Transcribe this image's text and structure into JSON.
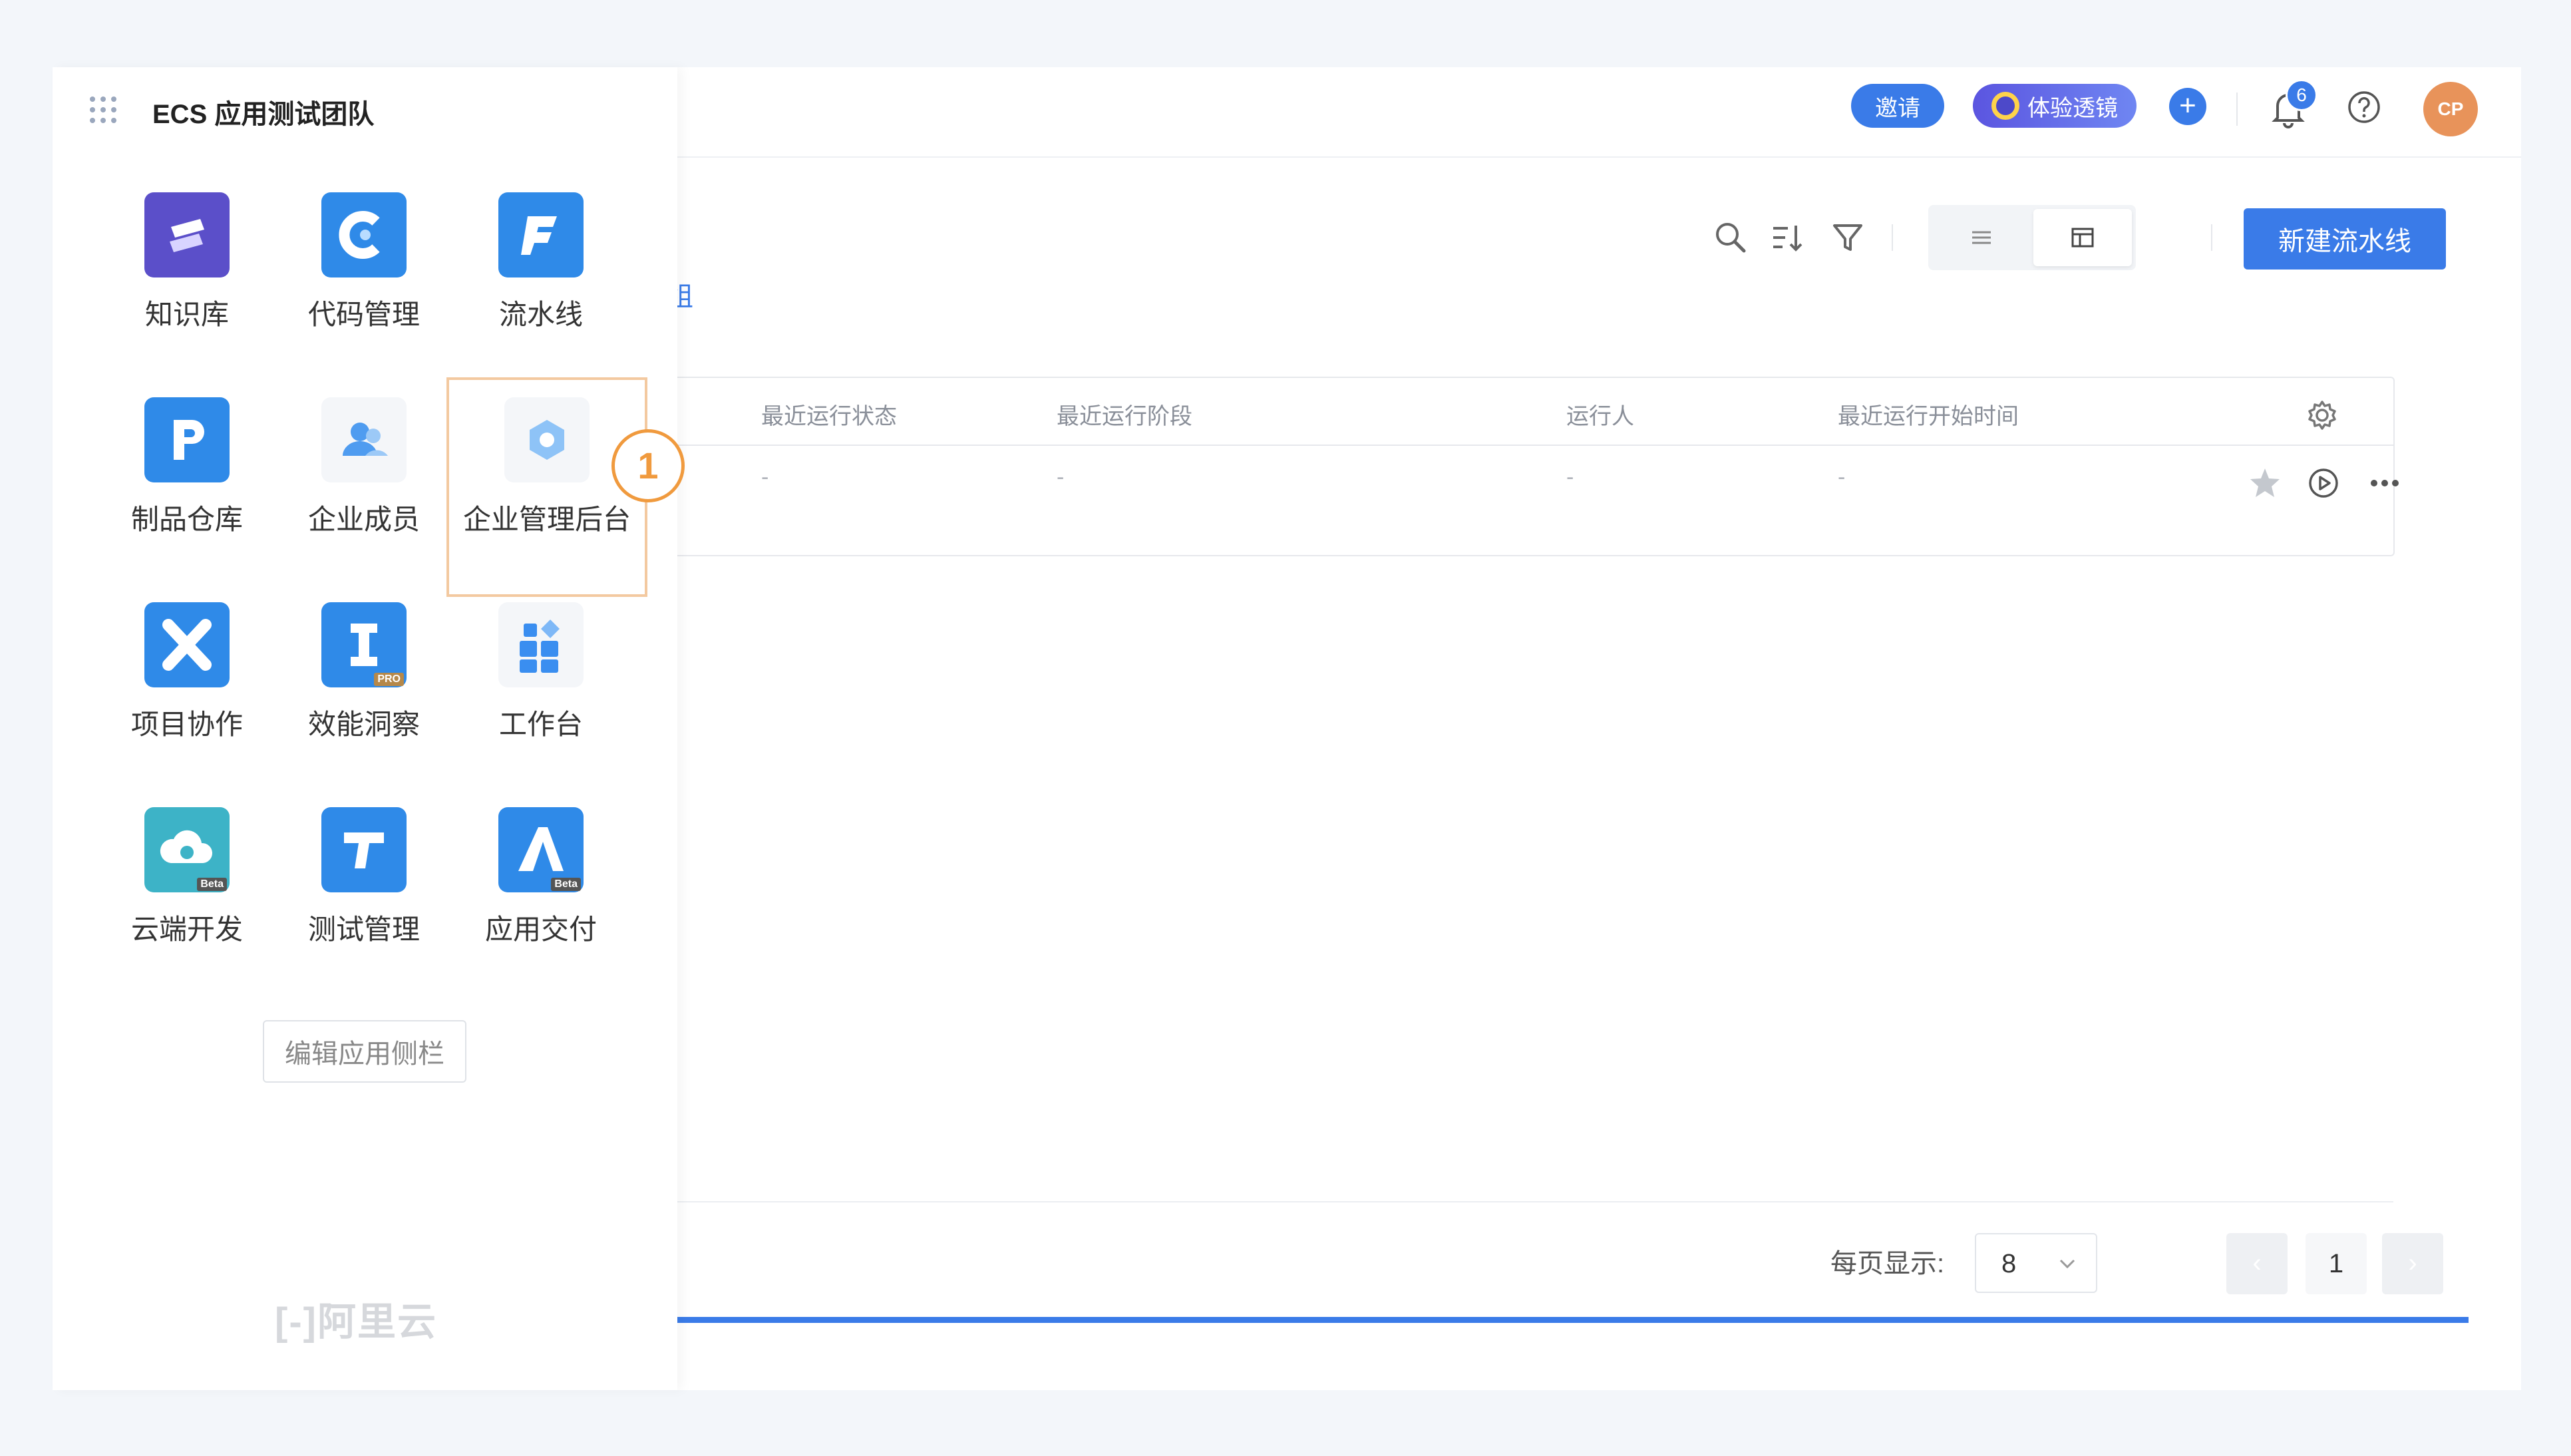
{
  "panel": {
    "title": "ECS 应用测试团队",
    "apps": [
      {
        "label": "知识库",
        "icon": "knowledge-base-icon",
        "color": "#5b4fc9"
      },
      {
        "label": "代码管理",
        "icon": "code-management-icon",
        "color": "#2f8ae8"
      },
      {
        "label": "流水线",
        "icon": "pipeline-icon",
        "color": "#2f8ae8"
      },
      {
        "label": "制品仓库",
        "icon": "artifact-repository-icon",
        "color": "#2f8ae8"
      },
      {
        "label": "企业成员",
        "icon": "enterprise-members-icon",
        "color": "#f4f6f9"
      },
      {
        "label": "企业管理后台",
        "icon": "enterprise-admin-icon",
        "color": "#f4f6f9"
      },
      {
        "label": "项目协作",
        "icon": "project-collaboration-icon",
        "color": "#2f8ae8"
      },
      {
        "label": "效能洞察",
        "icon": "insight-icon",
        "color": "#2f8ae8",
        "tag": "PRO"
      },
      {
        "label": "工作台",
        "icon": "workbench-icon",
        "color": "#f4f6f9"
      },
      {
        "label": "云端开发",
        "icon": "cloud-dev-icon",
        "color": "#3db3c7",
        "tag": "Beta"
      },
      {
        "label": "测试管理",
        "icon": "test-management-icon",
        "color": "#2f8ae8"
      },
      {
        "label": "应用交付",
        "icon": "app-delivery-icon",
        "color": "#2f8ae8",
        "tag": "Beta"
      }
    ],
    "edit_label": "编辑应用侧栏",
    "logo_text": "[-]阿里云"
  },
  "header": {
    "invite_label": "邀请",
    "lens_label": "体验透镜",
    "plus_label": "+",
    "notification_count": "6",
    "avatar_initials": "CP"
  },
  "toolbar": {
    "new_pipeline_label": "新建流水线",
    "view_modes": [
      "list-view-icon",
      "table-view-icon"
    ]
  },
  "tabs": {
    "favorites_label": "收藏组"
  },
  "table": {
    "headers": [
      "最近运行状态",
      "最近运行阶段",
      "运行人",
      "最近运行开始时间"
    ],
    "row": [
      "-",
      "-",
      "-",
      "-"
    ]
  },
  "callout": {
    "number": "1"
  },
  "pagination": {
    "per_page_label": "每页显示:",
    "per_page_value": "8",
    "prev": "‹",
    "next": "›",
    "current_page": "1"
  },
  "colors": {
    "accent": "#3a7be8",
    "callout": "#f09a3e"
  }
}
